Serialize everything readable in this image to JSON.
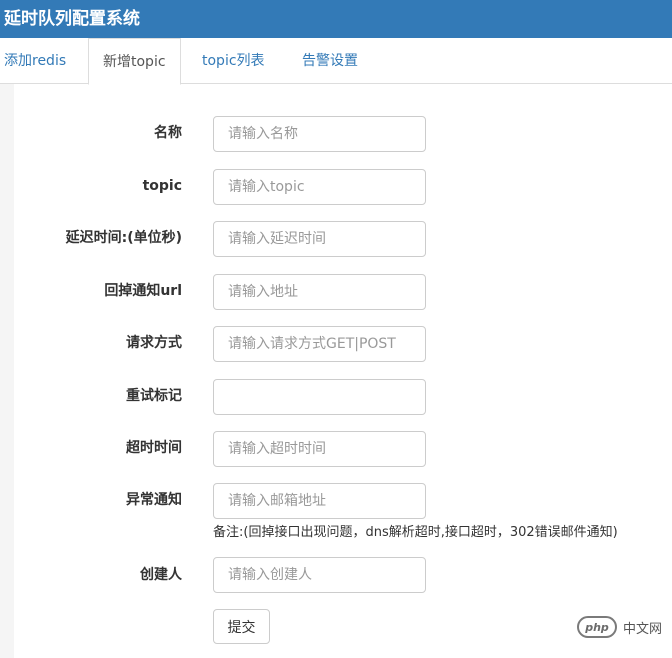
{
  "header": {
    "title": "延时队列配置系统"
  },
  "tabs": [
    {
      "label": "添加redis"
    },
    {
      "label": "新增topic",
      "active": true
    },
    {
      "label": "topic列表"
    },
    {
      "label": "告警设置"
    }
  ],
  "form": {
    "fields": [
      {
        "label": "名称",
        "value": "",
        "placeholder": "请输入名称"
      },
      {
        "label": "topic",
        "value": "",
        "placeholder": "请输入topic"
      },
      {
        "label": "延迟时间:(单位秒)",
        "value": "",
        "placeholder": "请输入延迟时间"
      },
      {
        "label": "回掉通知url",
        "value": "",
        "placeholder": "请输入地址"
      },
      {
        "label": "请求方式",
        "value": "",
        "placeholder": "请输入请求方式GET|POST"
      },
      {
        "label": "重试标记",
        "value": "",
        "placeholder": ""
      },
      {
        "label": "超时时间",
        "value": "",
        "placeholder": "请输入超时时间"
      },
      {
        "label": "异常通知",
        "value": "",
        "placeholder": "请输入邮箱地址"
      },
      {
        "label": "创建人",
        "value": "",
        "placeholder": "请输入创建人"
      }
    ],
    "note": "备注:(回掉接口出现问题，dns解析超时,接口超时，302错误邮件通知)",
    "submit_label": "提交"
  },
  "watermark": {
    "logo_text": "php",
    "text": "中文网"
  },
  "colors": {
    "header_bg": "#337ab7",
    "link": "#337ab7",
    "placeholder": "#999999"
  }
}
